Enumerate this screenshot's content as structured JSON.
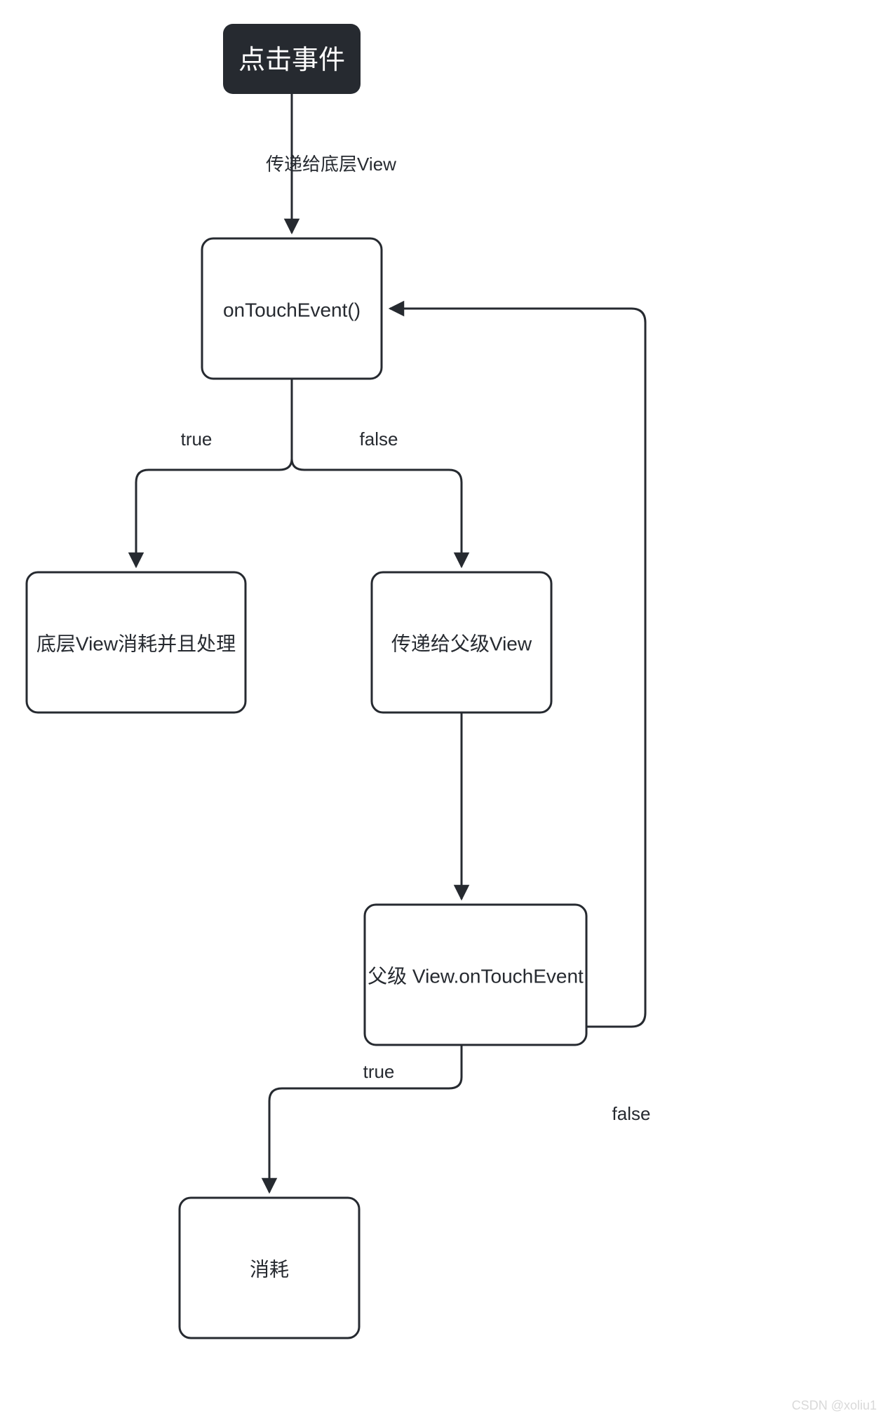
{
  "chart_data": {
    "type": "flowchart",
    "nodes": [
      {
        "id": "start",
        "label": "点击事件",
        "kind": "start"
      },
      {
        "id": "onTouch",
        "label": "onTouchEvent()",
        "kind": "process"
      },
      {
        "id": "consume",
        "label": "底层View消耗并且处理",
        "kind": "process"
      },
      {
        "id": "toParent",
        "label": "传递给父级View",
        "kind": "process"
      },
      {
        "id": "parentOnTouch",
        "label": "父级 View.onTouchEvent",
        "kind": "process"
      },
      {
        "id": "consumed",
        "label": "消耗",
        "kind": "process"
      }
    ],
    "edges": [
      {
        "from": "start",
        "to": "onTouch",
        "label": "传递给底层View"
      },
      {
        "from": "onTouch",
        "to": "consume",
        "label": "true"
      },
      {
        "from": "onTouch",
        "to": "toParent",
        "label": "false"
      },
      {
        "from": "toParent",
        "to": "parentOnTouch",
        "label": ""
      },
      {
        "from": "parentOnTouch",
        "to": "consumed",
        "label": "true"
      },
      {
        "from": "parentOnTouch",
        "to": "onTouch",
        "label": "false"
      }
    ]
  },
  "labels": {
    "start": "点击事件",
    "onTouch": "onTouchEvent()",
    "consume": "底层View消耗并且处理",
    "toParent": "传递给父级View",
    "parentOnTouch": "父级 View.onTouchEvent",
    "consumed": "消耗",
    "edge_start_onTouch": "传递给底层View",
    "edge_true": "true",
    "edge_false": "false",
    "edge_true2": "true",
    "edge_false2": "false"
  },
  "watermark": "CSDN @xoliu1"
}
